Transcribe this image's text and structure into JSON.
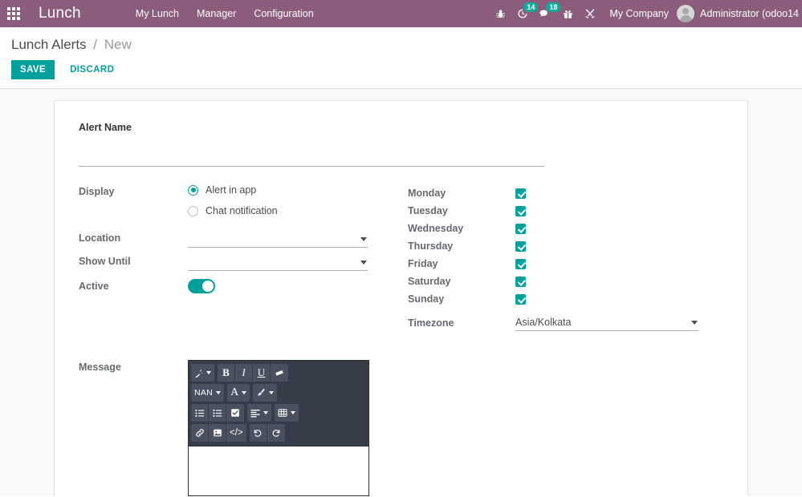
{
  "navbar": {
    "apps_icon": "apps-grid-icon",
    "brand": "Lunch",
    "menus": [
      {
        "label": "My Lunch"
      },
      {
        "label": "Manager"
      },
      {
        "label": "Configuration"
      }
    ],
    "sysicons": [
      {
        "name": "bug-icon",
        "badge": null
      },
      {
        "name": "activity-clock-icon",
        "badge": "14"
      },
      {
        "name": "messages-chat-icon",
        "badge": "18"
      },
      {
        "name": "gift-icon",
        "badge": null
      },
      {
        "name": "tools-wrench-icon",
        "badge": null
      }
    ],
    "company": "My Company",
    "user": "Administrator (odoo14",
    "accent_badge_color": "#0cab9b",
    "bar_color": "#8b5c7c"
  },
  "control_panel": {
    "breadcrumb_root": "Lunch Alerts",
    "breadcrumb_sep": "/",
    "breadcrumb_current": "New",
    "save_label": "SAVE",
    "discard_label": "DISCARD",
    "save_color": "#00a09d"
  },
  "form": {
    "title_label": "Alert Name",
    "title_value": "",
    "title_placeholder": "",
    "display_label": "Display",
    "display_options": [
      {
        "label": "Alert in app",
        "selected": true
      },
      {
        "label": "Chat notification",
        "selected": false
      }
    ],
    "location_label": "Location",
    "location_value": "",
    "show_until_label": "Show Until",
    "show_until_value": "",
    "active_label": "Active",
    "active_on": true,
    "weekdays": [
      {
        "label": "Monday",
        "checked": true
      },
      {
        "label": "Tuesday",
        "checked": true
      },
      {
        "label": "Wednesday",
        "checked": true
      },
      {
        "label": "Thursday",
        "checked": true
      },
      {
        "label": "Friday",
        "checked": true
      },
      {
        "label": "Saturday",
        "checked": true
      },
      {
        "label": "Sunday",
        "checked": true
      }
    ],
    "timezone_label": "Timezone",
    "timezone_value": "Asia/Kolkata",
    "message_label": "Message",
    "message_value": ""
  },
  "editor": {
    "toolbar_rows": [
      [
        {
          "name": "style-magic-wand-icon",
          "type": "icon",
          "dropdown": true
        },
        {
          "name": "bold-button",
          "type": "text",
          "text": "B"
        },
        {
          "name": "italic-button",
          "type": "text",
          "text": "I"
        },
        {
          "name": "underline-button",
          "type": "text",
          "text": "U"
        },
        {
          "name": "remove-format-eraser-icon",
          "type": "icon",
          "dropdown": false
        }
      ],
      [
        {
          "name": "font-size-button",
          "type": "text",
          "text": "NAN",
          "dropdown": true
        },
        {
          "name": "font-color-button",
          "type": "text",
          "text": "A",
          "dropdown": true
        },
        {
          "name": "background-color-brush-icon",
          "type": "icon",
          "dropdown": true
        }
      ],
      [
        {
          "name": "unordered-list-icon",
          "type": "icon",
          "dropdown": false
        },
        {
          "name": "ordered-list-icon",
          "type": "icon",
          "dropdown": false
        },
        {
          "name": "checklist-icon",
          "type": "icon",
          "dropdown": false
        },
        {
          "name": "align-icon",
          "type": "icon",
          "dropdown": true
        },
        {
          "name": "table-icon",
          "type": "icon",
          "dropdown": true
        }
      ],
      [
        {
          "name": "link-icon",
          "type": "icon",
          "dropdown": false
        },
        {
          "name": "image-icon",
          "type": "icon",
          "dropdown": false
        },
        {
          "name": "code-icon",
          "type": "text",
          "text": "</>"
        },
        {
          "name": "undo-icon",
          "type": "icon",
          "dropdown": false
        },
        {
          "name": "redo-icon",
          "type": "icon",
          "dropdown": false
        }
      ]
    ],
    "toolbar_bg": "#373c49",
    "button_bg": "#4a5060"
  }
}
